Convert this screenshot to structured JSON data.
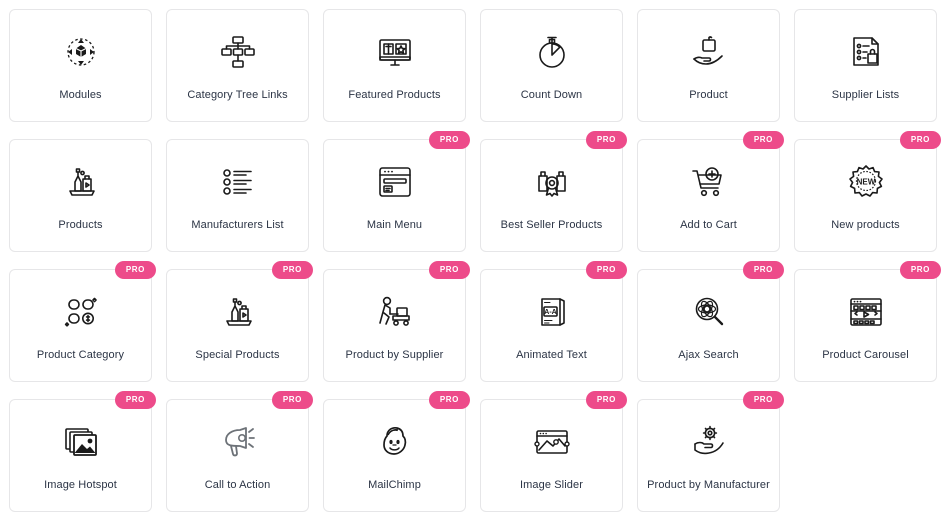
{
  "theme": {
    "background": "#ffffff",
    "card_background": "#ffffff",
    "card_border": "#e6e6e8",
    "label_color": "#2b3445",
    "badge_color": "#ed4b8a",
    "badge_text_color": "#ffffff",
    "icon_color": "#1a1a1a"
  },
  "badge": {
    "pro_label": "PRO"
  },
  "grid": {
    "columns": 6,
    "rows": 4,
    "cards": [
      {
        "label": "Modules",
        "icon": "modules-icon",
        "pro": false
      },
      {
        "label": "Category Tree Links",
        "icon": "category-tree-icon",
        "pro": false
      },
      {
        "label": "Featured Products",
        "icon": "featured-products-icon",
        "pro": false
      },
      {
        "label": "Count Down",
        "icon": "stopwatch-icon",
        "pro": false
      },
      {
        "label": "Product",
        "icon": "hand-product-icon",
        "pro": false
      },
      {
        "label": "Supplier Lists",
        "icon": "supplier-list-icon",
        "pro": false
      },
      {
        "label": "Products",
        "icon": "products-shelf-icon",
        "pro": false
      },
      {
        "label": "Manufacturers List",
        "icon": "bullet-list-icon",
        "pro": false
      },
      {
        "label": "Main Menu",
        "icon": "browser-menu-icon",
        "pro": true
      },
      {
        "label": "Best Seller Products",
        "icon": "best-seller-icon",
        "pro": true
      },
      {
        "label": "Add to Cart",
        "icon": "add-to-cart-icon",
        "pro": true
      },
      {
        "label": "New products",
        "icon": "new-badge-icon",
        "pro": true
      },
      {
        "label": "Product Category",
        "icon": "product-category-icon",
        "pro": true
      },
      {
        "label": "Special Products",
        "icon": "special-products-icon",
        "pro": true
      },
      {
        "label": "Product by Supplier",
        "icon": "supplier-worker-icon",
        "pro": true
      },
      {
        "label": "Animated Text",
        "icon": "animated-text-icon",
        "pro": true
      },
      {
        "label": "Ajax Search",
        "icon": "ajax-search-icon",
        "pro": true
      },
      {
        "label": "Product Carousel",
        "icon": "carousel-icon",
        "pro": true
      },
      {
        "label": "Image Hotspot",
        "icon": "image-hotspot-icon",
        "pro": true
      },
      {
        "label": "Call to Action",
        "icon": "megaphone-icon",
        "pro": true
      },
      {
        "label": "MailChimp",
        "icon": "mailchimp-icon",
        "pro": true
      },
      {
        "label": "Image Slider",
        "icon": "image-slider-icon",
        "pro": true
      },
      {
        "label": "Product by Manufacturer",
        "icon": "gear-hand-icon",
        "pro": true
      }
    ]
  }
}
